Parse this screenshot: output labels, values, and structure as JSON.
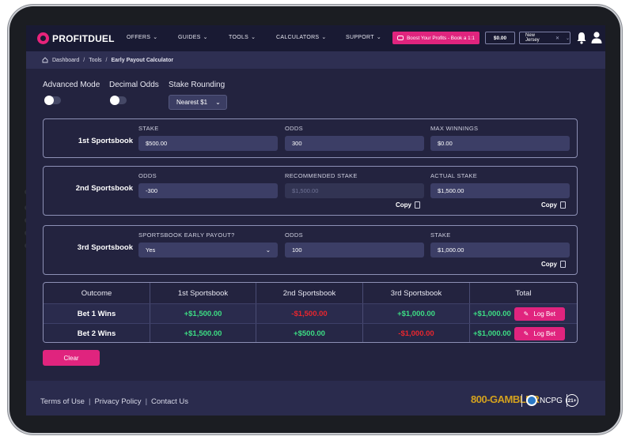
{
  "header": {
    "logo_text": "PROFITDUEL",
    "nav": [
      {
        "label": "OFFERS"
      },
      {
        "label": "GUIDES"
      },
      {
        "label": "TOOLS"
      },
      {
        "label": "CALCULATORS"
      },
      {
        "label": "SUPPORT"
      }
    ],
    "boost_label": "Boost Your Profits - Book a 1:1",
    "balance": "$0.00",
    "state": "New Jersey"
  },
  "breadcrumb": {
    "home": "Dashboard",
    "tools": "Tools",
    "current": "Early Payout Calculator"
  },
  "options": {
    "advanced_mode": {
      "label": "Advanced Mode",
      "on": false
    },
    "decimal_odds": {
      "label": "Decimal Odds",
      "on": false
    },
    "stake_rounding": {
      "label": "Stake Rounding",
      "value": "Nearest $1"
    }
  },
  "sportsbook1": {
    "title": "1st Sportsbook",
    "stake_label": "STAKE",
    "stake_value": "$500.00",
    "odds_label": "ODDS",
    "odds_value": "300",
    "max_label": "MAX WINNINGS",
    "max_value": "$0.00"
  },
  "sportsbook2": {
    "title": "2nd Sportsbook",
    "odds_label": "ODDS",
    "odds_value": "-300",
    "rec_label": "RECOMMENDED STAKE",
    "rec_value": "$1,500.00",
    "actual_label": "ACTUAL STAKE",
    "actual_value": "$1,500.00",
    "copy_rec": "Copy",
    "copy_actual": "Copy"
  },
  "sportsbook3": {
    "title": "3rd Sportsbook",
    "early_label": "SPORTSBOOK EARLY PAYOUT?",
    "early_value": "Yes",
    "odds_label": "ODDS",
    "odds_value": "100",
    "stake_label": "STAKE",
    "stake_value": "$1,000.00",
    "copy": "Copy"
  },
  "results": {
    "headers": [
      "Outcome",
      "1st Sportsbook",
      "2nd Sportsbook",
      "3rd Sportsbook",
      "Total"
    ],
    "rows": [
      {
        "outcome": "Bet 1 Wins",
        "sb1": "+$1,500.00",
        "sb2": "-$1,500.00",
        "sb3": "+$1,000.00",
        "total": "+$1,000.00",
        "action": "Log Bet"
      },
      {
        "outcome": "Bet 2 Wins",
        "sb1": "+$1,500.00",
        "sb2": "+$500.00",
        "sb3": "-$1,000.00",
        "total": "+$1,000.00",
        "action": "Log Bet"
      }
    ]
  },
  "clear_label": "Clear",
  "footer": {
    "links": [
      "Terms of Use",
      "Privacy Policy",
      "Contact Us"
    ],
    "gambler": "800-GAMBLER",
    "ncpg": "NCPG",
    "age": "21+"
  },
  "colors": {
    "accent": "#e0247e",
    "positive": "#3ddc84",
    "negative": "#e8262e",
    "background": "#23233f"
  }
}
